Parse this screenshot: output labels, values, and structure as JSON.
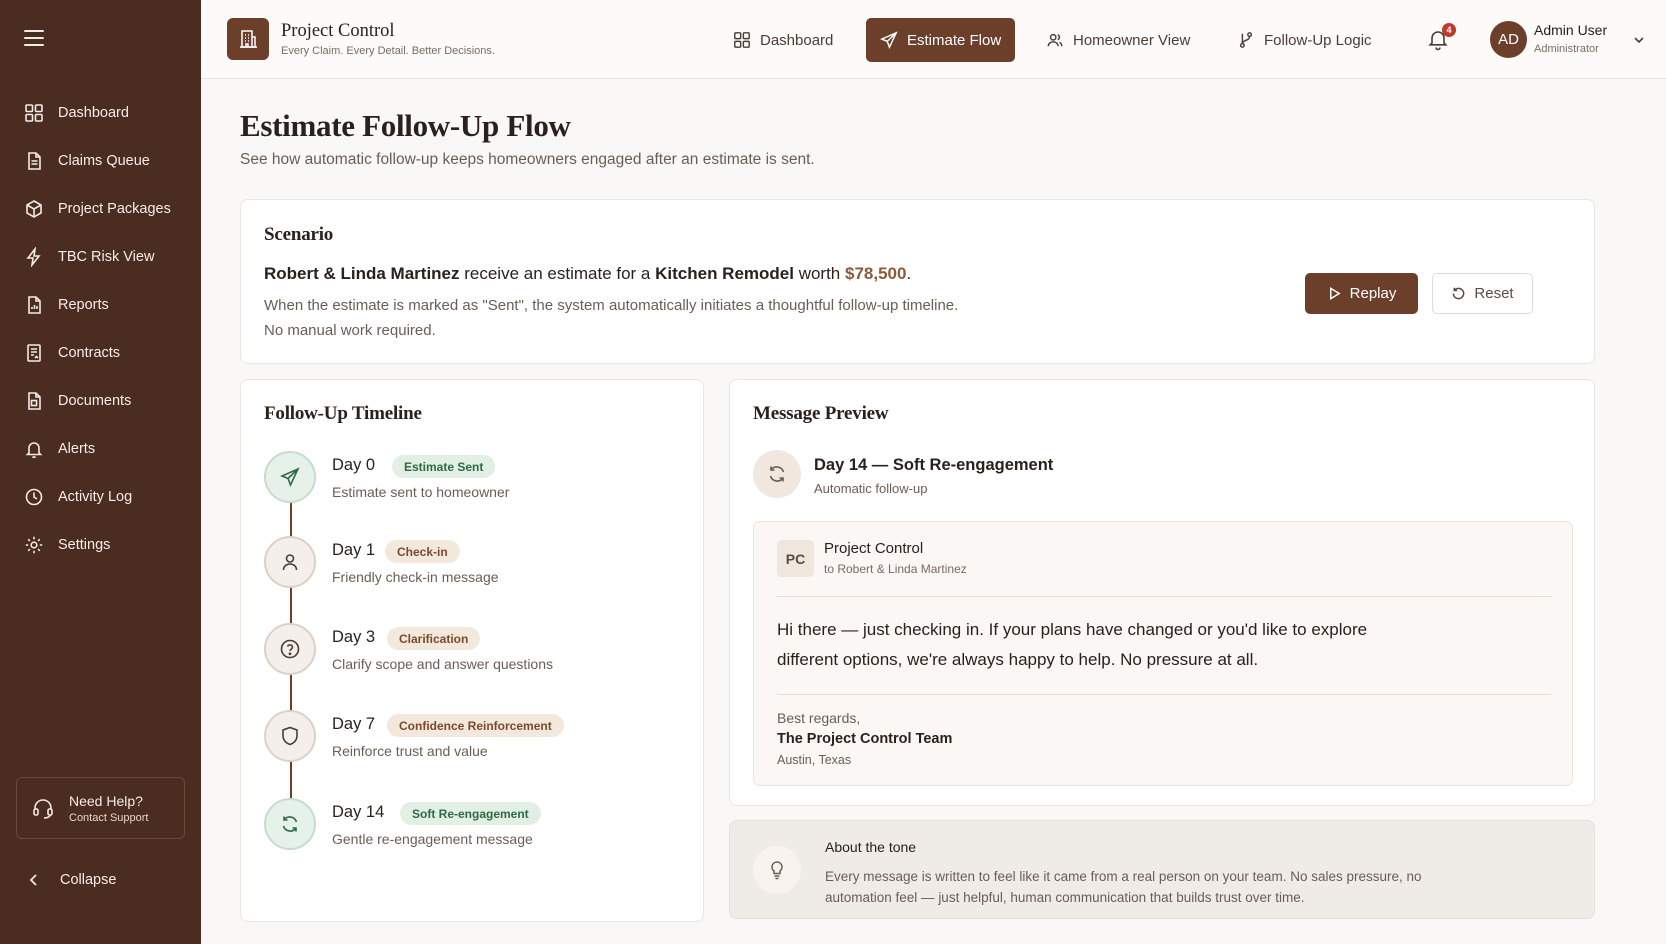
{
  "sidebar": {
    "items": [
      {
        "label": "Dashboard",
        "icon": "grid-icon"
      },
      {
        "label": "Claims Queue",
        "icon": "document-icon"
      },
      {
        "label": "Project Packages",
        "icon": "package-icon"
      },
      {
        "label": "TBC Risk View",
        "icon": "bolt-icon"
      },
      {
        "label": "Reports",
        "icon": "report-icon"
      },
      {
        "label": "Contracts",
        "icon": "contract-icon"
      },
      {
        "label": "Documents",
        "icon": "documents-icon"
      },
      {
        "label": "Alerts",
        "icon": "bell-icon"
      },
      {
        "label": "Activity Log",
        "icon": "clock-icon"
      },
      {
        "label": "Settings",
        "icon": "gear-icon"
      }
    ],
    "help": {
      "title": "Need Help?",
      "subtitle": "Contact Support"
    },
    "collapse_label": "Collapse"
  },
  "topbar": {
    "brand_title": "Project Control",
    "brand_subtitle": "Every Claim. Every Detail. Better Decisions.",
    "tabs": [
      {
        "label": "Dashboard",
        "active": false
      },
      {
        "label": "Estimate Flow",
        "active": true
      },
      {
        "label": "Homeowner View",
        "active": false
      },
      {
        "label": "Follow-Up Logic",
        "active": false
      }
    ],
    "notification_count": "4",
    "user": {
      "initials": "AD",
      "name": "Admin User",
      "role": "Administrator"
    }
  },
  "page": {
    "title": "Estimate Follow-Up Flow",
    "subtitle": "See how automatic follow-up keeps homeowners engaged after an estimate is sent."
  },
  "scenario": {
    "title": "Scenario",
    "customers": "Robert & Linda Martinez",
    "text_a": " receive an estimate for a ",
    "project": "Kitchen Remodel",
    "text_b": " worth ",
    "amount": "$78,500",
    "text_c": ".",
    "line2": "When the estimate is marked as \"Sent\", the system automatically initiates a thoughtful follow-up timeline.",
    "line3": "No manual work required.",
    "replay_label": "Replay",
    "reset_label": "Reset"
  },
  "timeline": {
    "title": "Follow-Up Timeline",
    "steps": [
      {
        "day": "Day 0",
        "tag": "Estimate Sent",
        "desc": "Estimate sent to homeowner",
        "icon": "send-icon"
      },
      {
        "day": "Day 1",
        "tag": "Check-in",
        "desc": "Friendly check-in message",
        "icon": "user-icon"
      },
      {
        "day": "Day 3",
        "tag": "Clarification",
        "desc": "Clarify scope and answer questions",
        "icon": "question-icon"
      },
      {
        "day": "Day 7",
        "tag": "Confidence Reinforcement",
        "desc": "Reinforce trust and value",
        "icon": "shield-icon"
      },
      {
        "day": "Day 14",
        "tag": "Soft Re-engagement",
        "desc": "Gentle re-engagement message",
        "icon": "refresh-icon"
      }
    ]
  },
  "preview": {
    "title": "Message Preview",
    "step_title": "Day 14 — Soft Re-engagement",
    "step_sub": "Automatic follow-up",
    "sender_initials": "PC",
    "sender": "Project Control",
    "recipient": "to Robert & Linda Martinez",
    "body": "Hi there — just checking in. If your plans have changed or you'd like to explore different options, we're always happy to help. No pressure at all.",
    "regards": "Best regards,",
    "team": "The Project Control Team",
    "location": "Austin, Texas"
  },
  "tone": {
    "title": "About the tone",
    "text": "Every message is written to feel like it came from a real person on your team. No sales pressure, no automation feel — just helpful, human communication that builds trust over time.",
    "icon": "lightbulb-icon"
  },
  "colors": {
    "sidebar_bg": "#4a2c20",
    "accent": "#6b3f2a",
    "amount": "#8a5a3c",
    "success_tag": "#2f6a44",
    "badge": "#c0392b"
  }
}
